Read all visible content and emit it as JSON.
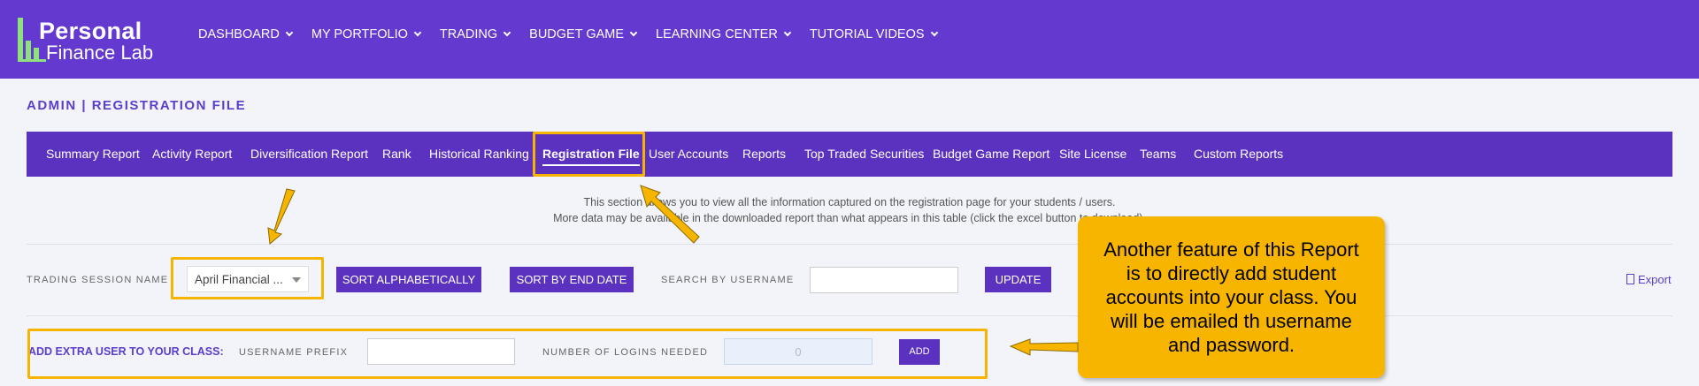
{
  "header": {
    "logo_line1": "Personal",
    "logo_line2": "Finance Lab",
    "nav": [
      {
        "label": "DASHBOARD"
      },
      {
        "label": "MY PORTFOLIO"
      },
      {
        "label": "TRADING"
      },
      {
        "label": "BUDGET GAME"
      },
      {
        "label": "LEARNING CENTER"
      },
      {
        "label": "TUTORIAL VIDEOS"
      }
    ]
  },
  "page_title": "ADMIN | REGISTRATION FILE",
  "tabs": [
    {
      "label": "Summary Report"
    },
    {
      "label": "Activity Report"
    },
    {
      "label": "Diversification Report"
    },
    {
      "label": "Rank"
    },
    {
      "label": "Historical Ranking"
    },
    {
      "label": "Registration File"
    },
    {
      "label": "User Accounts"
    },
    {
      "label": "Reports"
    },
    {
      "label": "Top Traded Securities"
    },
    {
      "label": "Budget Game Report"
    },
    {
      "label": "Site License"
    },
    {
      "label": "Teams"
    },
    {
      "label": "Custom Reports"
    }
  ],
  "info": {
    "line1": "This section allows you to view all the information captured on the registration page for your students / users.",
    "line2": "More data may be available in the downloaded report than what appears in this table (click the excel button to download)."
  },
  "filters": {
    "session_label": "TRADING SESSION NAME",
    "session_value": "April Financial ...",
    "sort_alpha": "SORT ALPHABETICALLY",
    "sort_end": "SORT BY END DATE",
    "search_label": "SEARCH BY USERNAME",
    "search_value": "",
    "update": "UPDATE",
    "export": "Export"
  },
  "add_user": {
    "label": "ADD EXTRA USER TO YOUR CLASS:",
    "prefix_label": "USERNAME PREFIX",
    "prefix_value": "",
    "logins_label": "NUMBER OF LOGINS NEEDED",
    "logins_value": "0",
    "add": "ADD"
  },
  "callout": {
    "lines": [
      "Another feature of this Report",
      "is to directly add student",
      "accounts into your class. You",
      "will be emailed th username",
      "and password."
    ]
  },
  "colors": {
    "topbar": "#6439d0",
    "tabbar": "#5b32c0",
    "accent": "#5b3ec9",
    "highlight": "#f4b400",
    "callout": "#f8b500",
    "logo_green": "#8ee07c"
  }
}
